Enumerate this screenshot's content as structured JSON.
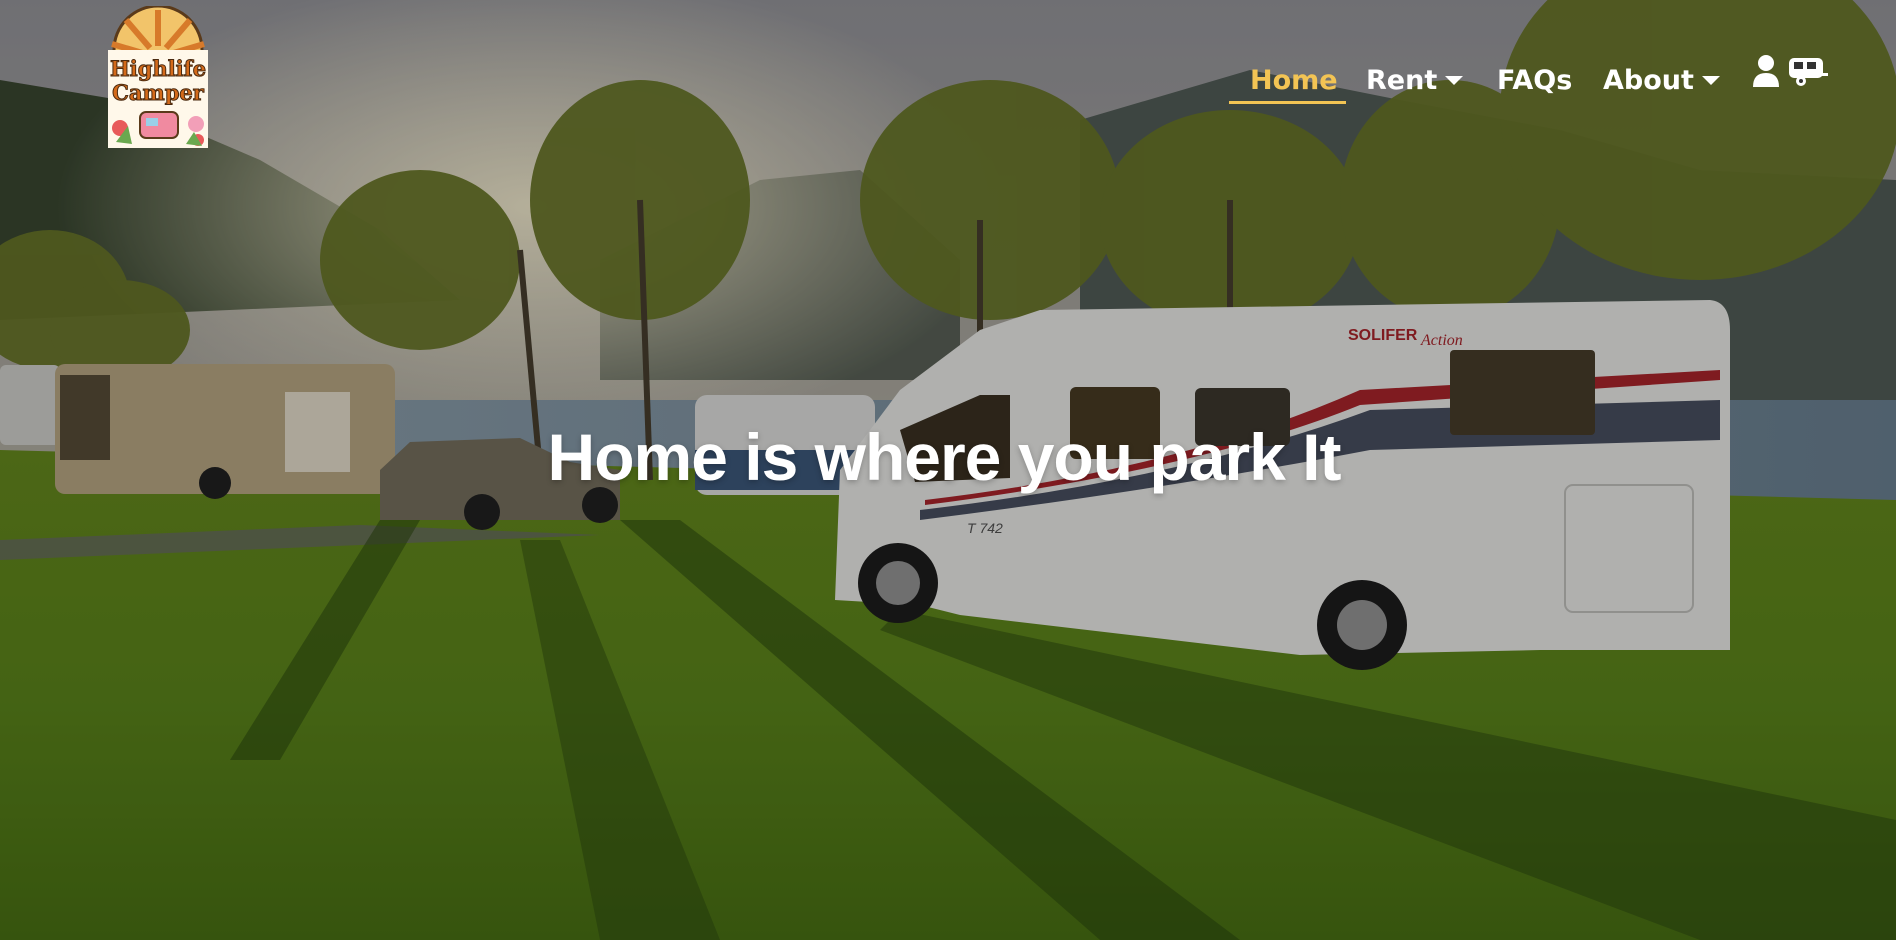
{
  "logo": {
    "line1": "Highlife",
    "line2": "Camper"
  },
  "nav": {
    "items": [
      {
        "label": "Home",
        "active": true,
        "dropdown": false
      },
      {
        "label": "Rent",
        "active": false,
        "dropdown": true
      },
      {
        "label": "FAQs",
        "active": false,
        "dropdown": false
      },
      {
        "label": "About",
        "active": false,
        "dropdown": true
      }
    ],
    "icons": [
      "user-icon",
      "camper-van-icon"
    ]
  },
  "hero": {
    "headline": "Home is where you park It",
    "rv_brand": "SOLIFER",
    "rv_model": "Action",
    "rv_plate": "T 742"
  },
  "colors": {
    "accent": "#f3c454",
    "nav_text": "#ffffff"
  }
}
